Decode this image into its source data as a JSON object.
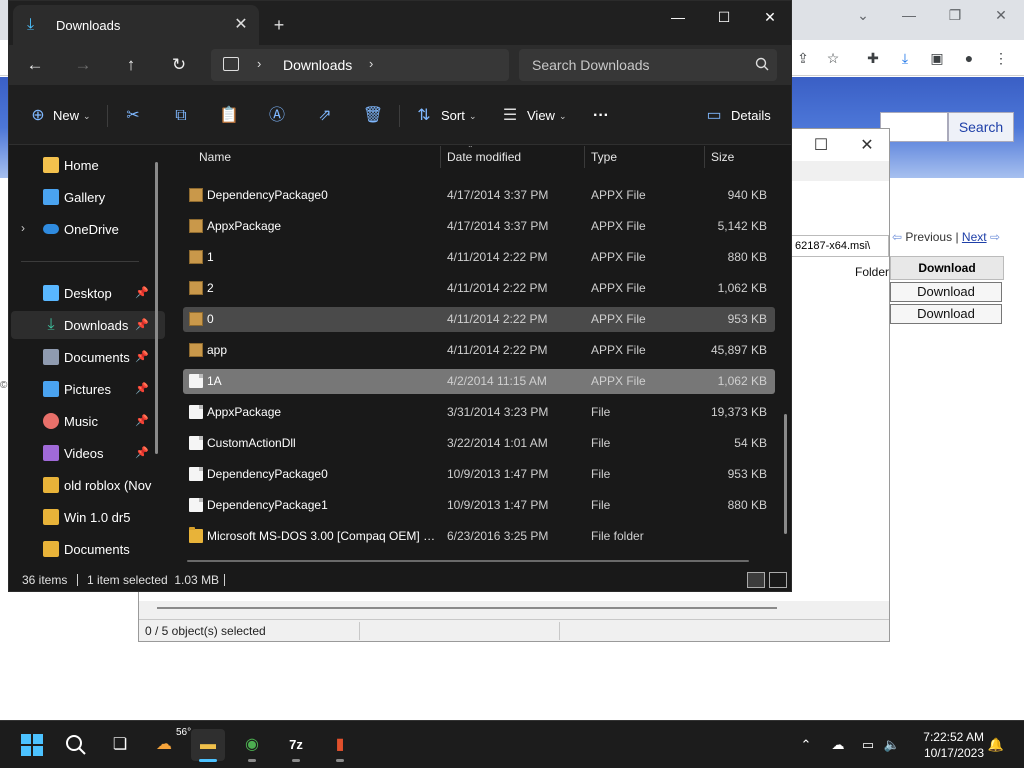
{
  "explorer": {
    "tab_title": "Downloads",
    "breadcrumb": [
      "Downloads"
    ],
    "search_placeholder": "Search Downloads",
    "toolbar": {
      "new_label": "New",
      "sort_label": "Sort",
      "view_label": "View",
      "more_label": "···",
      "details_label": "Details"
    },
    "nav_items": [
      {
        "label": "Home",
        "icon": "home-icon",
        "color": "#f3c14d"
      },
      {
        "label": "Gallery",
        "icon": "gallery-icon",
        "color": "#4aa3f0"
      },
      {
        "label": "OneDrive",
        "icon": "onedrive-icon",
        "color": "#2f8bdf"
      },
      {
        "label": "Desktop",
        "icon": "desktop-icon",
        "color": "#59b7ff"
      },
      {
        "label": "Downloads",
        "icon": "download-icon",
        "color": "#3ec3a0"
      },
      {
        "label": "Documents",
        "icon": "documents-icon",
        "color": "#8f9bb0"
      },
      {
        "label": "Pictures",
        "icon": "pictures-icon",
        "color": "#4aa3f0"
      },
      {
        "label": "Music",
        "icon": "music-icon",
        "color": "#e8706a"
      },
      {
        "label": "Videos",
        "icon": "videos-icon",
        "color": "#a06ad8"
      },
      {
        "label": "old roblox (Nov",
        "icon": "folder-icon",
        "color": "#e8b339"
      },
      {
        "label": "Win 1.0 dr5",
        "icon": "folder-icon",
        "color": "#e8b339"
      },
      {
        "label": "Documents",
        "icon": "folder-icon",
        "color": "#e8b339"
      }
    ],
    "columns": {
      "name": "Name",
      "date": "Date modified",
      "type": "Type",
      "size": "Size"
    },
    "files": [
      {
        "name": "DependencyPackage0",
        "date": "4/17/2014 3:37 PM",
        "type": "APPX File",
        "size": "940 KB",
        "icon": "appx-file-icon"
      },
      {
        "name": "AppxPackage",
        "date": "4/17/2014 3:37 PM",
        "type": "APPX File",
        "size": "5,142 KB",
        "icon": "appx-file-icon"
      },
      {
        "name": "1",
        "date": "4/11/2014 2:22 PM",
        "type": "APPX File",
        "size": "880 KB",
        "icon": "appx-file-icon"
      },
      {
        "name": "2",
        "date": "4/11/2014 2:22 PM",
        "type": "APPX File",
        "size": "1,062 KB",
        "icon": "appx-file-icon"
      },
      {
        "name": "0",
        "date": "4/11/2014 2:22 PM",
        "type": "APPX File",
        "size": "953 KB",
        "icon": "appx-file-icon"
      },
      {
        "name": "app",
        "date": "4/11/2014 2:22 PM",
        "type": "APPX File",
        "size": "45,897 KB",
        "icon": "appx-file-icon"
      },
      {
        "name": "1A",
        "date": "4/2/2014 11:15 AM",
        "type": "APPX File",
        "size": "1,062 KB",
        "icon": "file-icon"
      },
      {
        "name": "AppxPackage",
        "date": "3/31/2014 3:23 PM",
        "type": "File",
        "size": "19,373 KB",
        "icon": "file-icon"
      },
      {
        "name": "CustomActionDll",
        "date": "3/22/2014 1:01 AM",
        "type": "File",
        "size": "54 KB",
        "icon": "file-icon"
      },
      {
        "name": "DependencyPackage0",
        "date": "10/9/2013 1:47 PM",
        "type": "File",
        "size": "953 KB",
        "icon": "file-icon"
      },
      {
        "name": "DependencyPackage1",
        "date": "10/9/2013 1:47 PM",
        "type": "File",
        "size": "880 KB",
        "icon": "file-icon"
      },
      {
        "name": "Microsoft MS-DOS 3.00 [Compaq OEM] (...",
        "date": "6/23/2016 3:25 PM",
        "type": "File folder",
        "size": "",
        "icon": "folder-icon"
      }
    ],
    "status": {
      "count": "36 items",
      "selected": "1 item selected  1.03 MB"
    }
  },
  "zip_dialog": {
    "combo_text": "62187-x64.msi\\",
    "folder_header": "Folder",
    "status_text": "0 / 5 object(s) selected"
  },
  "browser": {
    "search_button": "Search",
    "nav_previous": "Previous",
    "nav_separator": "|",
    "nav_next": "Next",
    "table_header": "Download",
    "download_buttons": [
      "Download",
      "Download"
    ]
  },
  "taskbar": {
    "weather": "56°",
    "time": "7:22:52 AM",
    "date": "10/17/2023"
  }
}
